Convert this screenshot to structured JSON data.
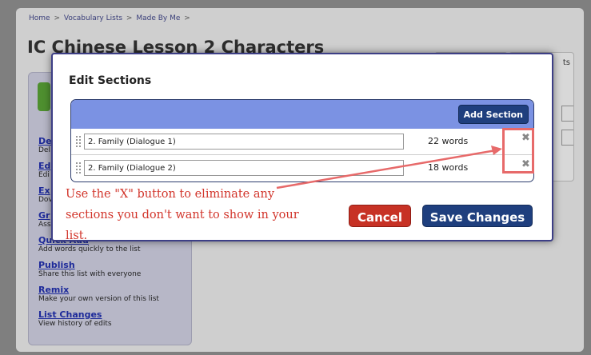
{
  "breadcrumb": {
    "items": [
      "Home",
      "Vocabulary Lists",
      "Made By Me"
    ],
    "separator": ">"
  },
  "page": {
    "title": "IC Chinese Lesson 2 Characters",
    "right_panel_fragment": "ts"
  },
  "sidebar": {
    "items": [
      {
        "link": "De",
        "desc": "Del"
      },
      {
        "link": "Ed",
        "desc": "Edi"
      },
      {
        "link": "Ex",
        "desc": "Dov"
      },
      {
        "link": "Gr",
        "desc": "Assi"
      },
      {
        "link": "Quick Add",
        "desc": "Add words quickly to the list"
      },
      {
        "link": "Publish",
        "desc": "Share this list with everyone"
      },
      {
        "link": "Remix",
        "desc": "Make your own version of this list"
      },
      {
        "link": "List Changes",
        "desc": "View history of edits"
      }
    ]
  },
  "modal": {
    "title": "Edit Sections",
    "add_section_label": "Add Section",
    "sections": [
      {
        "name": "2. Family (Dialogue 1)",
        "count": "22 words"
      },
      {
        "name": "2. Family (Dialogue 2)",
        "count": "18 words"
      }
    ],
    "delete_glyph": "✖",
    "cancel_label": "Cancel",
    "save_label": "Save Changes"
  },
  "annotation": {
    "text": "Use the \"X\" button to eliminate any sections you don't want to show in your list.",
    "color": "#d2352b"
  },
  "colors": {
    "header_blue": "#7b92e3",
    "button_navy": "#1f3f7e",
    "cancel_red": "#c73225",
    "annotation_red": "#e76a6a"
  }
}
